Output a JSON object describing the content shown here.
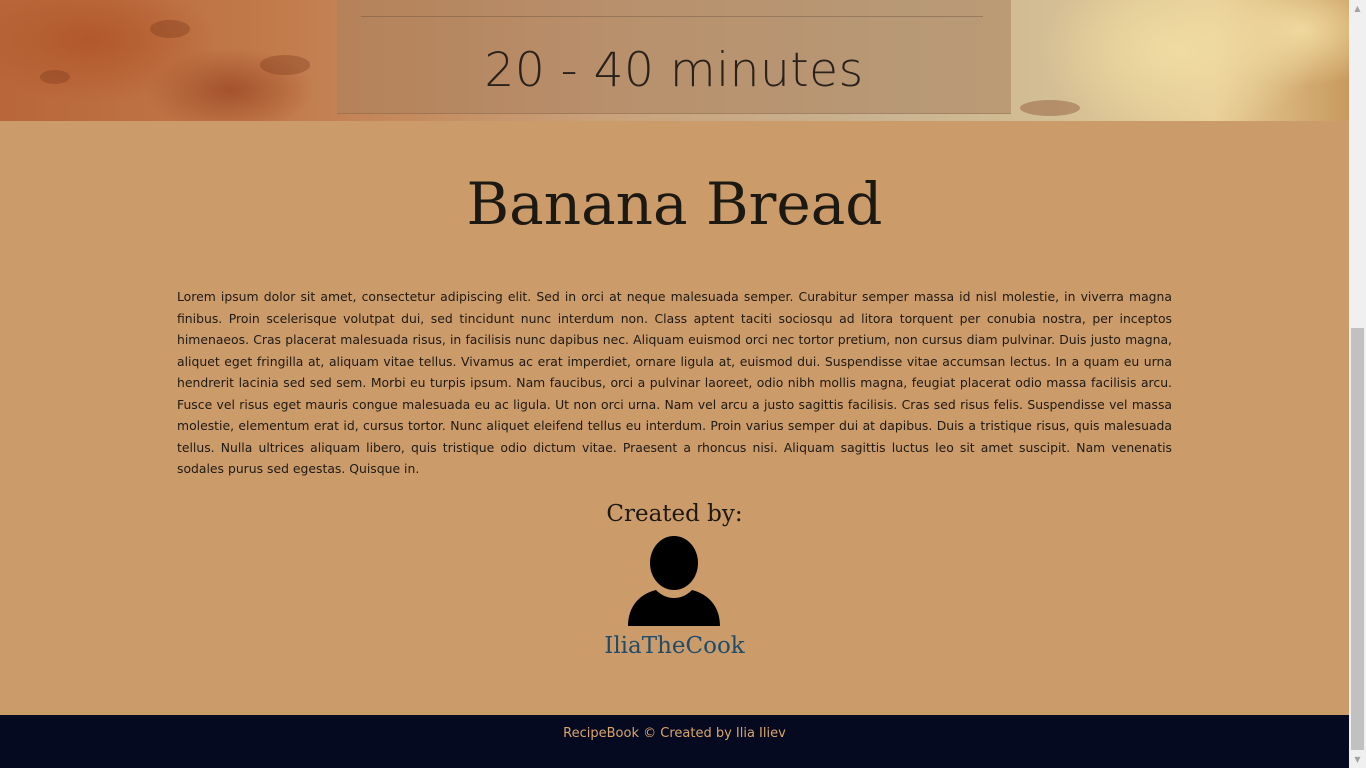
{
  "hero": {
    "time": "20 - 40 minutes"
  },
  "recipe": {
    "title": "Banana Bread",
    "description": "Lorem ipsum dolor sit amet, consectetur adipiscing elit. Sed in orci at neque malesuada semper. Curabitur semper massa id nisl molestie, in viverra magna finibus. Proin scelerisque volutpat dui, sed tincidunt nunc interdum non. Class aptent taciti sociosqu ad litora torquent per conubia nostra, per inceptos himenaeos. Cras placerat malesuada risus, in facilisis nunc dapibus nec. Aliquam euismod orci nec tortor pretium, non cursus diam pulvinar. Duis justo magna, aliquet eget fringilla at, aliquam vitae tellus. Vivamus ac erat imperdiet, ornare ligula at, euismod dui. Suspendisse vitae accumsan lectus. In a quam eu urna hendrerit lacinia sed sed sem. Morbi eu turpis ipsum. Nam faucibus, orci a pulvinar laoreet, odio nibh mollis magna, feugiat placerat odio massa facilisis arcu. Fusce vel risus eget mauris congue malesuada eu ac ligula. Ut non orci urna. Nam vel arcu a justo sagittis facilisis. Cras sed risus felis. Suspendisse vel massa molestie, elementum erat id, cursus tortor. Nunc aliquet eleifend tellus eu interdum. Proin varius semper dui at dapibus. Duis a tristique risus, quis malesuada tellus. Nulla ultrices aliquam libero, quis tristique odio dictum vitae. Praesent a rhoncus nisi. Aliquam sagittis luctus leo sit amet suscipit. Nam venenatis sodales purus sed egestas. Quisque in.",
    "created_by_label": "Created by:",
    "author": "IliaTheCook",
    "author_icon": "user-icon"
  },
  "footer": {
    "text": "RecipeBook © Created by Ilia Iliev"
  },
  "colors": {
    "background": "#cc9b6a",
    "footer_bg": "#050a20",
    "footer_text": "#d9a56c",
    "link": "#1f4c6a"
  }
}
